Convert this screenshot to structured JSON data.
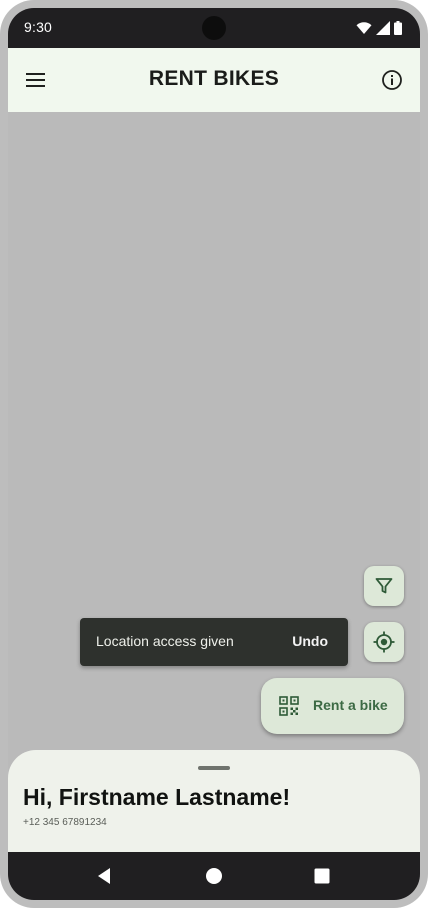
{
  "status_bar": {
    "time": "9:30"
  },
  "app_bar": {
    "title": "RENT BIKES",
    "menu_icon": "menu-icon",
    "info_icon": "info-icon"
  },
  "map": {
    "filter_icon": "filter-icon",
    "location_icon": "my-location-icon"
  },
  "snackbar": {
    "message": "Location access given",
    "action": "Undo"
  },
  "rent_fab": {
    "label": "Rent a bike",
    "icon": "qr-code-icon"
  },
  "bottom_sheet": {
    "greeting": "Hi, Firstname Lastname!",
    "phone": "+12 345 67891234"
  },
  "colors": {
    "app_bar_bg": "#f1f8ee",
    "accent": "#3c6a44",
    "fab_bg": "#dde8d8",
    "snackbar_bg": "#2e312d",
    "system_bar": "#201f21"
  }
}
